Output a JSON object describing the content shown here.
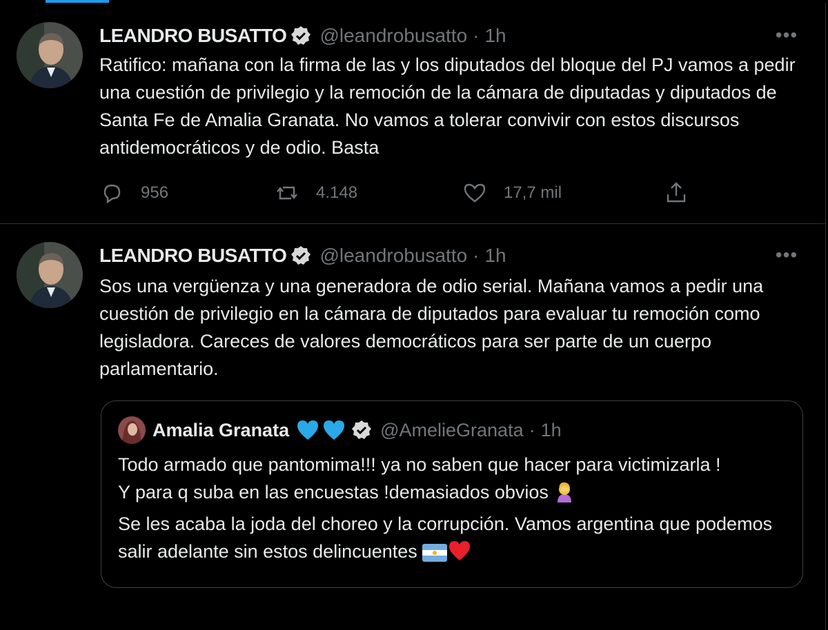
{
  "tweets": [
    {
      "author_name": "LEANDRO BUSATTO",
      "handle": "@leandrobusatto",
      "separator": "·",
      "time": "1h",
      "more_label": "•••",
      "text": "Ratifico: mañana con la firma de las y los diputados del bloque del PJ vamos a pedir una cuestión de privilegio y la remoción de la cámara de diputadas y diputados de Santa Fe de Amalia Granata. No vamos a tolerar convivir con estos discursos antidemocráticos y de odio. Basta",
      "replies": "956",
      "retweets": "4.148",
      "likes": "17,7 mil"
    },
    {
      "author_name": "LEANDRO BUSATTO",
      "handle": "@leandrobusatto",
      "separator": "·",
      "time": "1h",
      "more_label": "•••",
      "text": "Sos una vergüenza y una generadora de odio serial. Mañana vamos a pedir una cuestión de privilegio en la cámara de diputados para evaluar tu remoción como legisladora. Careces de valores democráticos para ser parte de un cuerpo parlamentario.",
      "quote": {
        "author_name": "Amalia Granata",
        "handle": "@AmelieGranata",
        "separator": "·",
        "time": "1h",
        "lines": [
          "Todo armado que pantomima!!! ya no saben que hacer para victimizarla !",
          "Y para q suba en las encuestas !demasiados obvios",
          "Se les acaba la joda del choreo y la corrupción. Vamos argentina que podemos salir adelante sin estos delincuentes"
        ]
      }
    }
  ],
  "icons": {
    "verified": "verified-badge-icon",
    "reply": "reply-icon",
    "retweet": "retweet-icon",
    "like": "like-icon",
    "share": "share-icon",
    "blue_heart": "blue-heart-emoji",
    "facepalm": "facepalm-emoji",
    "argentina_flag": "argentina-flag-emoji",
    "red_heart": "red-heart-emoji"
  },
  "colors": {
    "background": "#000000",
    "text": "#e7e9ea",
    "secondary": "#71767b",
    "accent": "#1d9bf0",
    "border": "#2f3336"
  }
}
